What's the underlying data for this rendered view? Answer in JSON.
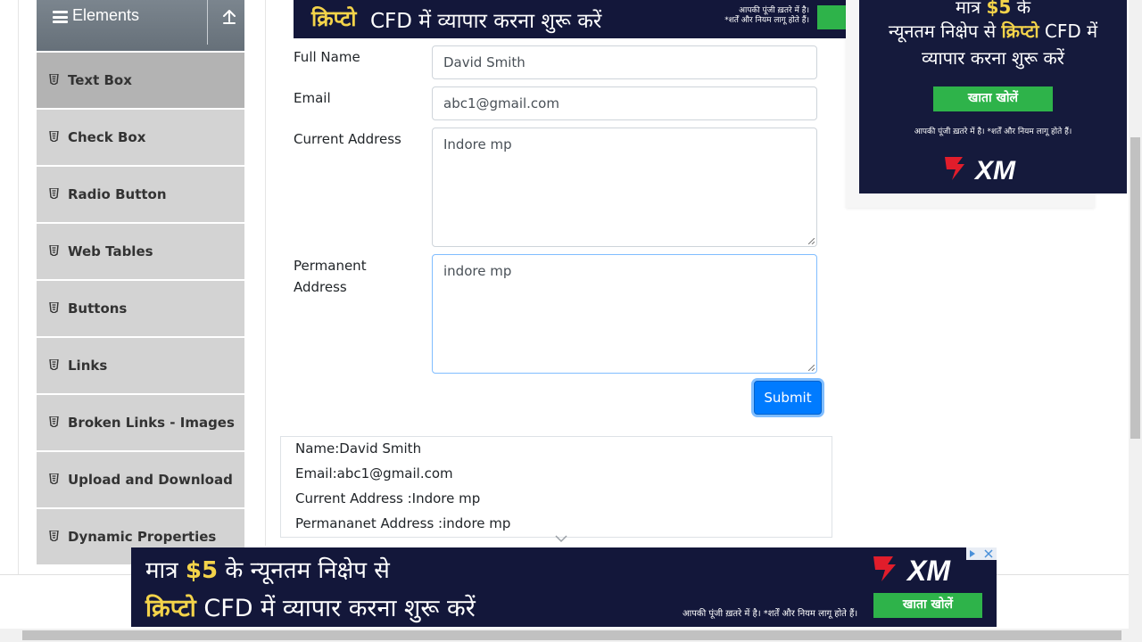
{
  "sidebar": {
    "group_title": "Elements",
    "items": [
      {
        "label": "Text Box",
        "active": true
      },
      {
        "label": "Check Box"
      },
      {
        "label": "Radio Button"
      },
      {
        "label": "Web Tables"
      },
      {
        "label": "Buttons"
      },
      {
        "label": "Links"
      },
      {
        "label": "Broken Links - Images"
      },
      {
        "label": "Upload and Download"
      },
      {
        "label": "Dynamic Properties"
      }
    ]
  },
  "form": {
    "full_name_label": "Full Name",
    "full_name_value": "David Smith",
    "email_label": "Email",
    "email_value": "abc1@gmail.com",
    "current_address_label": "Current Address",
    "current_address_value": "Indore mp",
    "permanent_address_label_1": "Permanent",
    "permanent_address_label_2": "Address",
    "permanent_address_value": "indore mp",
    "submit_label": "Submit"
  },
  "output": {
    "name": "Name:David Smith",
    "email": "Email:abc1@gmail.com",
    "current_address": "Current Address :Indore mp",
    "permanent_address": "Permananet Address :indore mp"
  },
  "ads": {
    "top": {
      "brand": "क्रिप्टो",
      "rest": "CFD में  व्यापार करना शुरू करें",
      "fine_1": "आपकी पूंजी ख़तरे में है।",
      "fine_2": "*शर्तें और नियम लागू होते हैं।"
    },
    "right": {
      "line1_pre": "मात्र",
      "line1_amount": "$5",
      "line1_post": "के",
      "line2_pre": "न्यूनतम निक्षेप से",
      "line2_brand": "क्रिप्टो",
      "line2_post": "CFD में",
      "line3": "व्यापार करना शुरू करें",
      "button": "खाता खोलें",
      "fine": "आपकी पूंजी ख़तरे में है। *शर्तें और नियम लागू होते हैं।",
      "logo": "XM"
    },
    "bottom": {
      "line1_pre": "मात्र",
      "line1_amount": "$5",
      "line1_post": "के न्यूनतम निक्षेप से",
      "line2_brand": "क्रिप्टो",
      "line2_post": "CFD में  व्यापार करना शुरू करें",
      "fine": "आपकी पूंजी ख़तरे में है। *शर्तें और नियम लागू होते हैं।",
      "button": "खाता खोलें",
      "logo": "XM"
    }
  },
  "colors": {
    "primary": "#007bff",
    "ad_bg": "#13173a",
    "ad_green": "#2eb34a",
    "ad_yellow": "#f3d34a",
    "sidebar_item": "#d3d3d3",
    "sidebar_active": "#b3b3b3"
  },
  "icons": {
    "menu": "hamburger-icon",
    "collapse": "arrow-up-icon",
    "item": "html5-icon",
    "chevron": "chevron-down-icon",
    "logo": "xm-logo"
  }
}
